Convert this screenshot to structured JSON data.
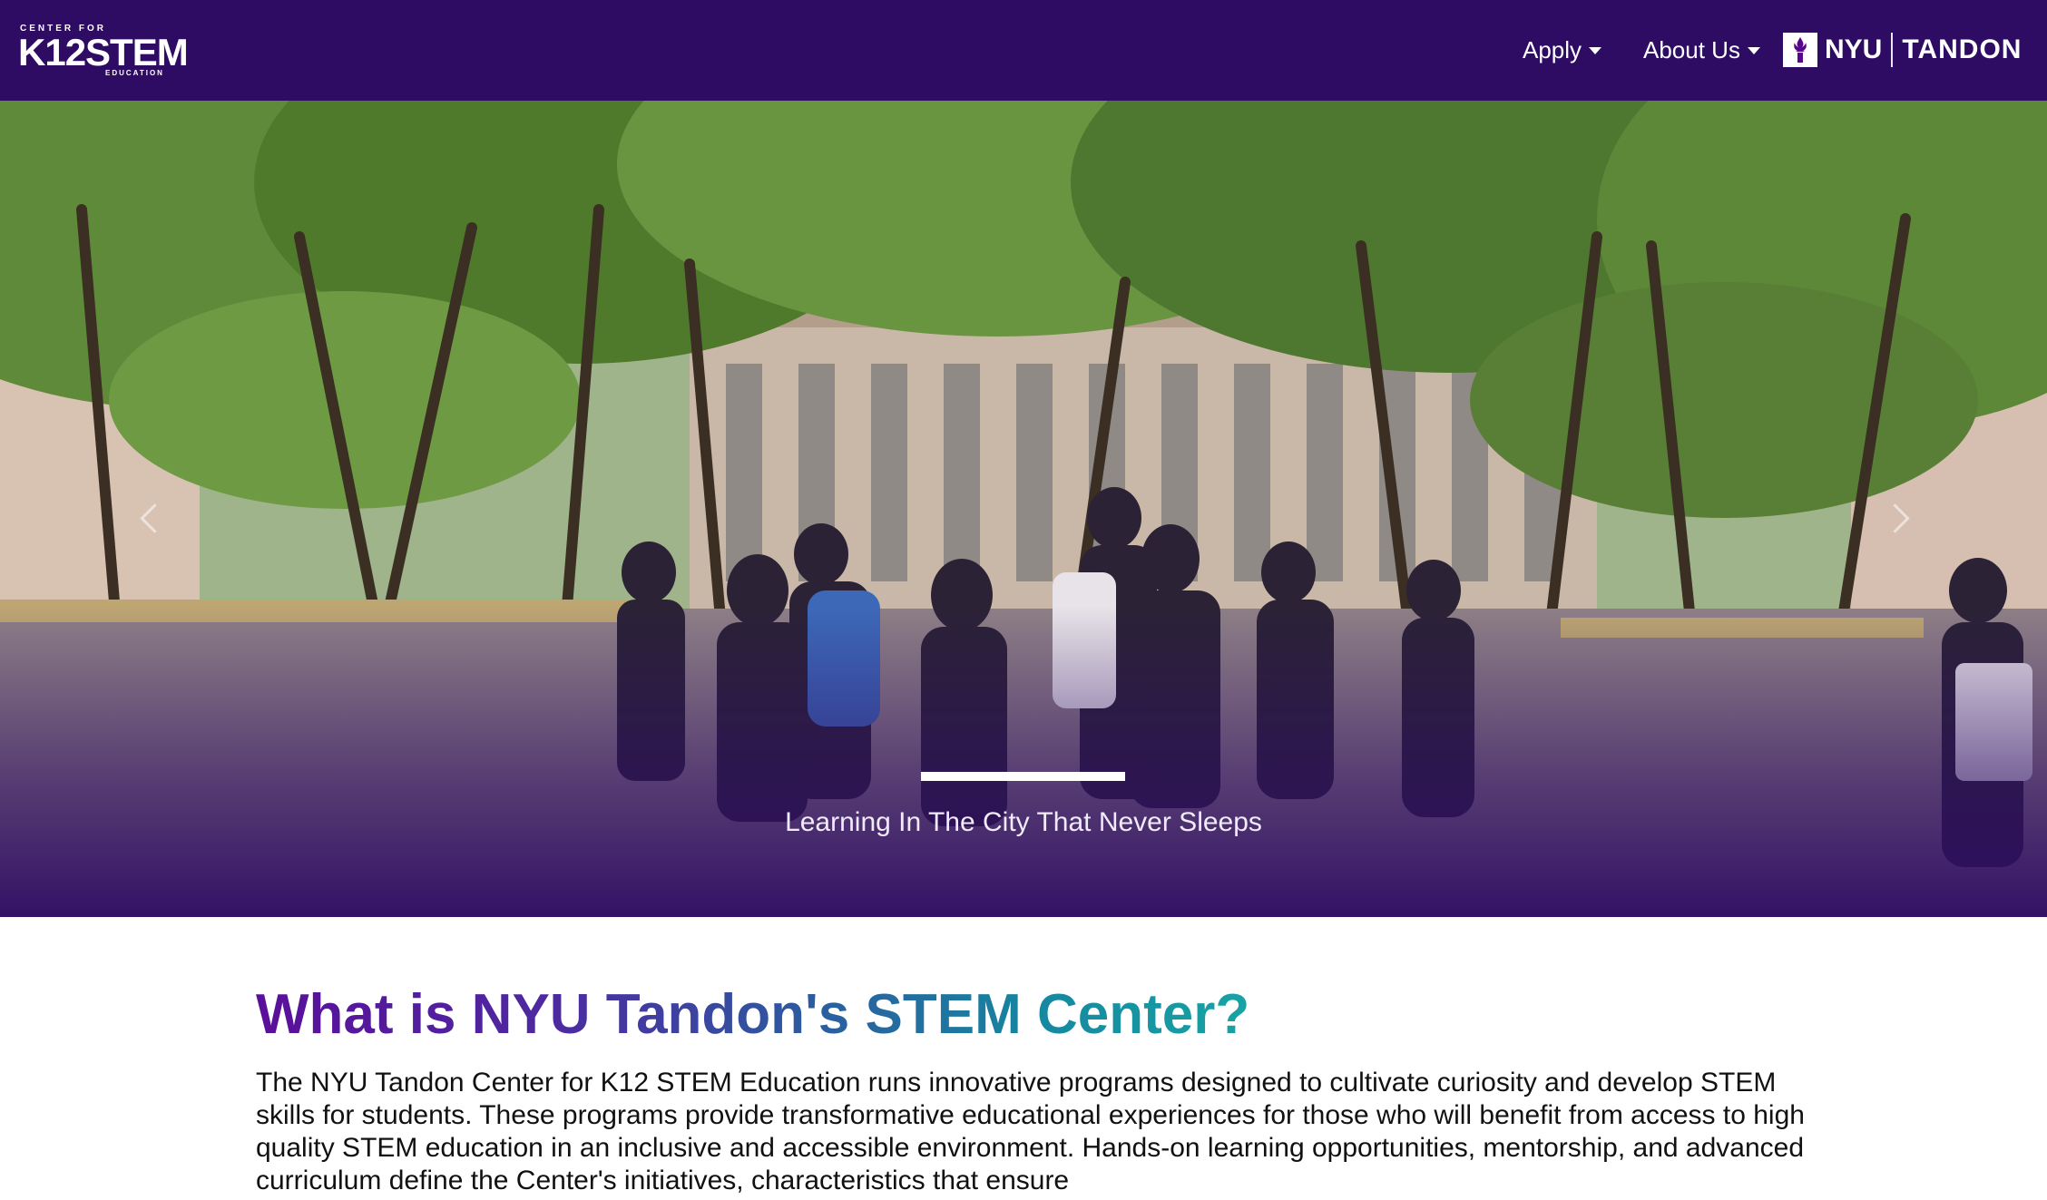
{
  "navbar": {
    "logo": {
      "top_text": "CENTER FOR",
      "main_text": "K12STEM",
      "bottom_text": "EDUCATION"
    },
    "links": [
      {
        "label": "Apply",
        "has_dropdown": true
      },
      {
        "label": "About Us",
        "has_dropdown": true
      }
    ],
    "brand": {
      "left": "NYU",
      "right": "TANDON",
      "icon": "torch-icon"
    },
    "background_color": "#2e0c64"
  },
  "hero": {
    "caption": "Learning In The City That Never Sleeps",
    "active_slide": 1,
    "overlay_color": "#2e0c64"
  },
  "intro": {
    "heading": "What is NYU Tandon's STEM Center?",
    "paragraph": "The NYU Tandon Center for K12 STEM Education runs innovative programs designed to cultivate curiosity and develop STEM skills for students. These programs provide transformative educational experiences for those who will benefit from access to high quality STEM education in an inclusive and accessible environment. Hands-on learning opportunities, mentorship, and advanced curriculum define the Center's initiatives, characteristics that ensure",
    "heading_gradient": [
      "#5a0f9a",
      "#18a3a3"
    ]
  }
}
